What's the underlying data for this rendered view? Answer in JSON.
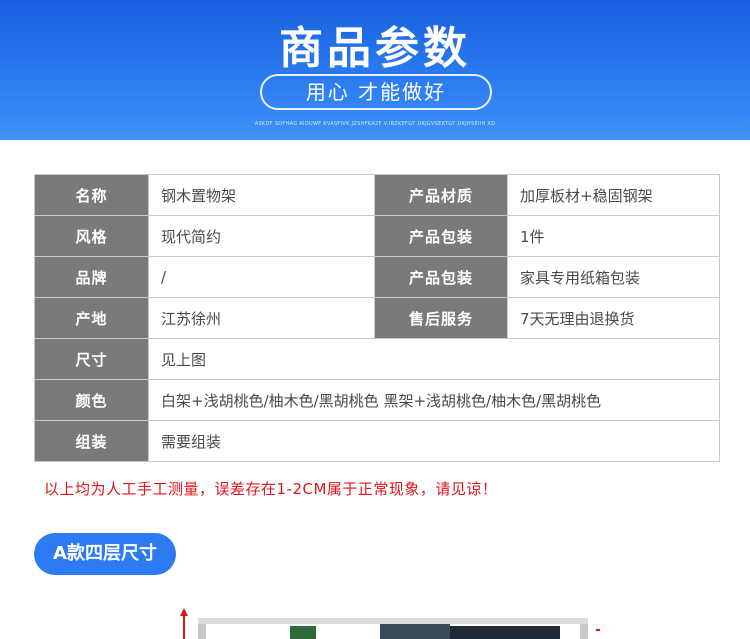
{
  "header": {
    "title": "商品参数",
    "slogan": "用心 才能做好",
    "tiny_text": "ASKDF SDFHAG AIOUWF KVASFIVK.JZSHFKAZF V.IBZKEFGY DKJGVSEKTGY DKJHSEIIH XD"
  },
  "table": {
    "rows": [
      {
        "label1": "名称",
        "value1": "钢木置物架",
        "label2": "产品材质",
        "value2": "加厚板材+稳固钢架"
      },
      {
        "label1": "风格",
        "value1": "现代简约",
        "label2": "产品包装",
        "value2": "1件"
      },
      {
        "label1": "品牌",
        "value1": "/",
        "label2": "产品包装",
        "value2": "家具专用纸箱包装"
      },
      {
        "label1": "产地",
        "value1": "江苏徐州",
        "label2": "售后服务",
        "value2": "7天无理由退换货"
      },
      {
        "label1": "尺寸",
        "value1": "见上图"
      },
      {
        "label1": "颜色",
        "value1": "白架+浅胡桃色/柚木色/黑胡桃色  黑架+浅胡桃色/柚木色/黑胡桃色"
      },
      {
        "label1": "组装",
        "value1": "需要组装"
      }
    ]
  },
  "note": "以上均为人工手工测量，误差存在1-2CM属于正常现象，请见谅！",
  "section_badge": "A款四层尺寸",
  "colors": {
    "banner_blue": "#2a7bf0",
    "label_gray": "#7a7a7a",
    "note_red": "#e0141e",
    "badge_blue": "#2d7bf3"
  }
}
